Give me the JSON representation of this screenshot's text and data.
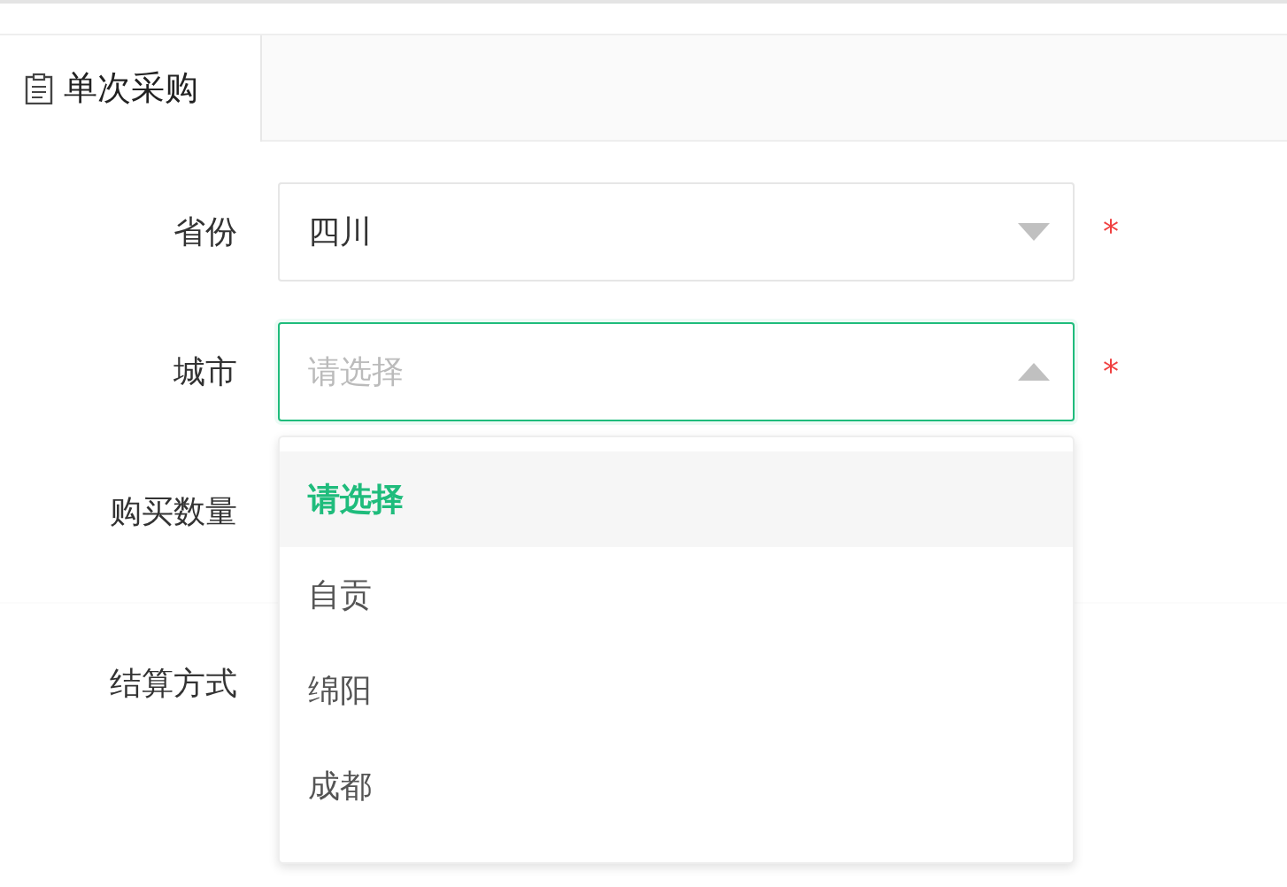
{
  "tabs": [
    {
      "label": "单次采购",
      "selected": true
    }
  ],
  "fields": [
    {
      "label": "省份",
      "value": "四川",
      "required_mark": "*",
      "expanded": false
    },
    {
      "label": "城市",
      "placeholder": "请选择",
      "required_mark": "*",
      "expanded": true,
      "options": [
        {
          "label": "请选择",
          "selected": true
        },
        {
          "label": "自贡",
          "selected": false
        },
        {
          "label": "绵阳",
          "selected": false
        },
        {
          "label": "成都",
          "selected": false
        }
      ]
    },
    {
      "label": "购买数量"
    }
  ],
  "section_2": {
    "fields": [
      {
        "label": "结算方式"
      }
    ]
  }
}
